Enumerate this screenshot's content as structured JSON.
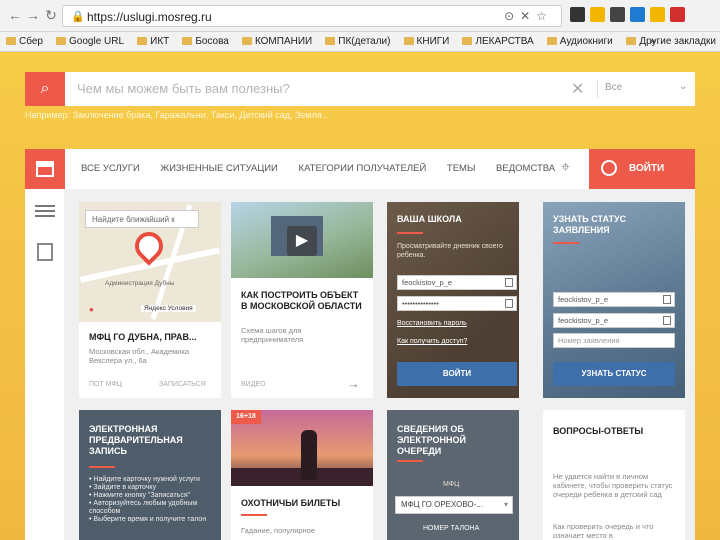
{
  "browser": {
    "url": "https://uslugi.mosreg.ru",
    "bookmarks": [
      "Сбер",
      "Google URL",
      "ИКТ",
      "Босова",
      "КОМПАНИИ",
      "ПК(детали)",
      "КНИГИ",
      "ЛЕКАРСТВА",
      "Аудиокниги"
    ],
    "bookmarks_more": "»",
    "bookmarks_other": "Другие закладки",
    "ext_colors": [
      "#333333",
      "#f2b600",
      "#444444",
      "#1f7bd1",
      "#f2b600",
      "#d32f2f"
    ]
  },
  "search": {
    "placeholder": "Чем мы можем быть вам полезны?",
    "scope": "Все",
    "hint": "Например: Заключение брака, Гаражальни, Такси, Детский сад, Земля..."
  },
  "nav": {
    "items": [
      "ВСЕ УСЛУГИ",
      "ЖИЗНЕННЫЕ СИТУАЦИИ",
      "КАТЕГОРИИ ПОЛУЧАТЕЛЕЙ",
      "ТЕМЫ",
      "ВЕДОМСТВА"
    ],
    "login": "ВОЙТИ"
  },
  "cards": {
    "mfc": {
      "find_placeholder": "Найдите ближайший к",
      "map_label": "Администрация Дубны",
      "map_credit": "Яндекс Условия",
      "title": "МФЦ ГО ДУБНА, ПРАВ...",
      "address": "Московская обл., Академика Векслера ул., 6а",
      "tag1": "ПОТ МФЦ",
      "tag2": "ЗАПИСАТЬСЯ"
    },
    "build": {
      "title": "КАК ПОСТРОИТЬ ОБЪЕКТ В МОСКОВСКОЙ ОБЛАСТИ",
      "sub": "Схема шагов для предпринимателя",
      "tag": "ВИДЕО"
    },
    "school": {
      "title": "ВАША ШКОЛА",
      "text": "Просматривайте дневник своего ребенка.",
      "login_value": "feockistov_p_e",
      "password_value": "••••••••••••••",
      "restore": "Восстановить пароль",
      "how": "Как получить доступ?",
      "button": "ВОЙТИ"
    },
    "status": {
      "title": "УЗНАТЬ СТАТУС ЗАЯВЛЕНИЯ",
      "login_value": "feockistov_p_e",
      "login_value2": "feockistov_p_e",
      "number_placeholder": "Номер заявления",
      "button": "УЗНАТЬ СТАТУС"
    },
    "queue": {
      "title": "ЭЛЕКТРОННАЯ ПРЕДВАРИТЕЛЬНАЯ ЗАПИСЬ",
      "bullets": [
        "Найдите карточку нужной услуги",
        "Зайдите в карточку",
        "Нажмите кнопку \"Записаться\"",
        "Авторизуйтесь любым удобным способом",
        "Выберите время и получите талон"
      ]
    },
    "hunting": {
      "badge": "16+18",
      "title": "ОХОТНИЧЬИ БИЛЕТЫ",
      "sub": "Гадание, популярное"
    },
    "equeue": {
      "title": "СВЕДЕНИЯ ОБ ЭЛЕКТРОННОЙ ОЧЕРЕДИ",
      "mfc_label": "МФЦ",
      "select": "МФЦ ГО ОРЕХОВО-...",
      "ticket_label": "НОМЕР ТАЛОНА"
    },
    "faq": {
      "title": "ВОПРОСЫ-ОТВЕТЫ",
      "q1": "Не удается найти в личном кабинете, чтобы проверить статус очереди ребенка в детский сад",
      "q2": "Как проверить очередь и что означает место в"
    }
  }
}
